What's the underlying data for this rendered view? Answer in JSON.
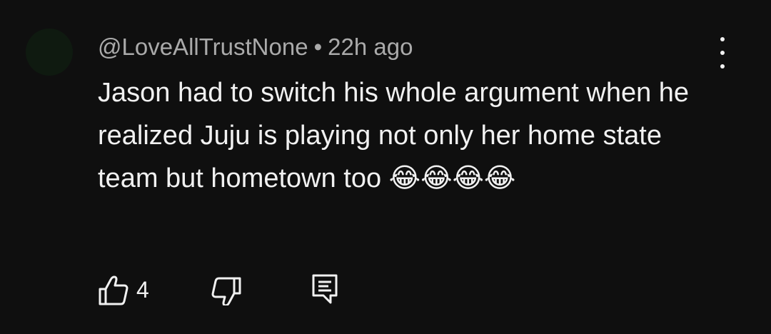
{
  "comment": {
    "author": "@LoveAllTrustNone",
    "separator": "•",
    "time": "22h ago",
    "text": "Jason had to switch his whole argument when he realized Juju is playing not only her home state team but hometown too 😂😂😂😂",
    "like_count": "4"
  },
  "icons": {
    "avatar": "avatar",
    "menu": "more-vert-icon",
    "like": "thumb-up-icon",
    "dislike": "thumb-down-icon",
    "reply": "reply-icon"
  },
  "colors": {
    "background": "#0f0f0f",
    "text": "#f1f1f1",
    "secondary_text": "#aaaaaa"
  }
}
